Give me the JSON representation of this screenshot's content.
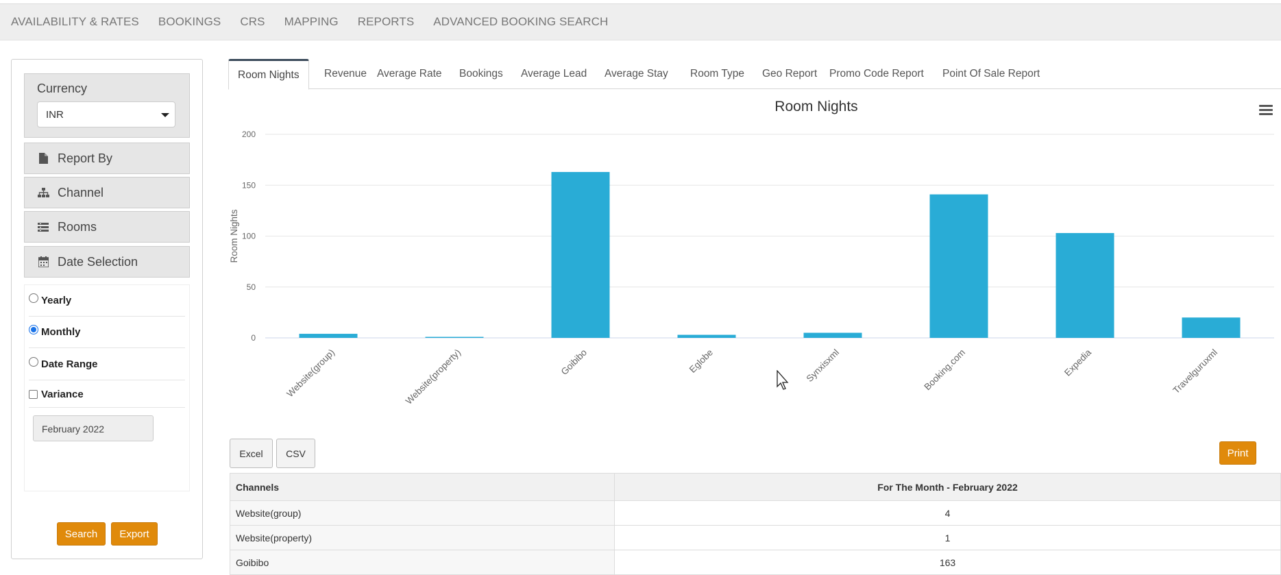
{
  "nav": [
    "AVAILABILITY & RATES",
    "BOOKINGS",
    "CRS",
    "MAPPING",
    "REPORTS",
    "ADVANCED BOOKING SEARCH"
  ],
  "sidebar": {
    "currency_label": "Currency",
    "currency_value": "INR",
    "report_by": "Report By",
    "channel": "Channel",
    "rooms": "Rooms",
    "date_selection": "Date Selection",
    "options": {
      "yearly": "Yearly",
      "monthly": "Monthly",
      "date_range": "Date Range",
      "variance": "Variance"
    },
    "selected_option": "Monthly",
    "month_value": "February 2022",
    "search": "Search",
    "export": "Export"
  },
  "tabs": [
    "Room Nights",
    "Revenue",
    "Average Rate",
    "Bookings",
    "Average Lead",
    "Average Stay",
    "Room Type",
    "Geo Report",
    "Promo Code Report",
    "Point Of Sale Report"
  ],
  "active_tab": "Room Nights",
  "chart_data": {
    "type": "bar",
    "title": "Room Nights",
    "ylabel": "Room Nights",
    "xlabel": "",
    "categories": [
      "Website(group)",
      "Website(property)",
      "Goibibo",
      "Eglobe",
      "Synxisxml",
      "Booking.com",
      "Expedia",
      "Travelguruxml"
    ],
    "values": [
      4,
      1,
      163,
      3,
      5,
      141,
      103,
      20
    ],
    "ylim": [
      0,
      200
    ],
    "yticks": [
      0,
      50,
      100,
      150,
      200
    ],
    "grid": true,
    "color": "#29acd6"
  },
  "buttons": {
    "excel": "Excel",
    "csv": "CSV",
    "print": "Print"
  },
  "table": {
    "headers": [
      "Channels",
      "For The Month - February 2022"
    ],
    "rows": [
      [
        "Website(group)",
        "4"
      ],
      [
        "Website(property)",
        "1"
      ],
      [
        "Goibibo",
        "163"
      ]
    ]
  },
  "colors": {
    "accent": "#e08a0b",
    "bar": "#29acd6"
  }
}
